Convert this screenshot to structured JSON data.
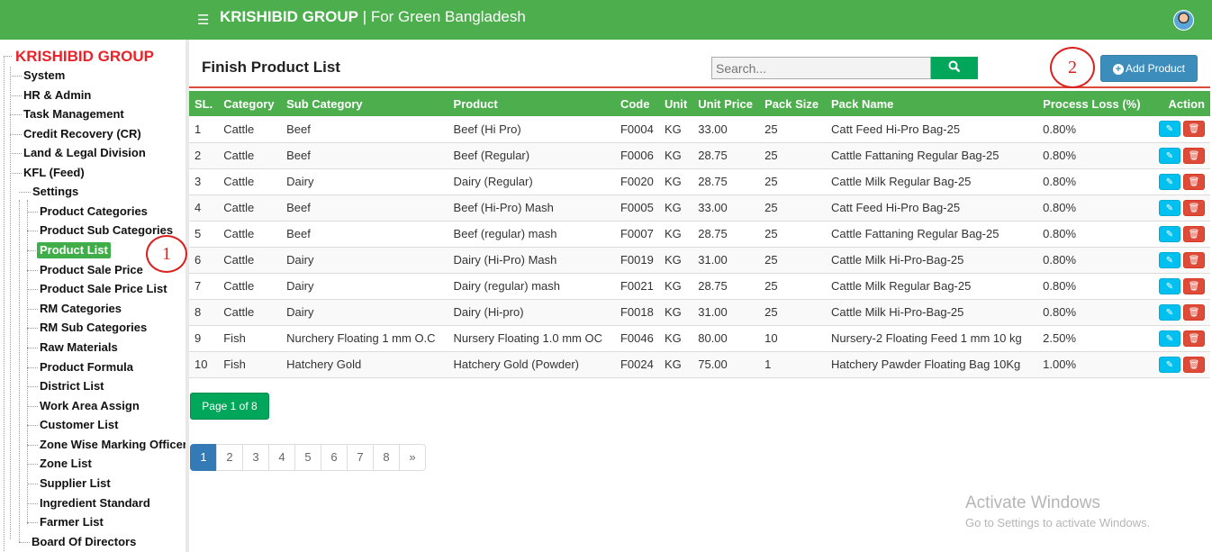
{
  "header": {
    "brand_bold": "KRISHIBID GROUP",
    "brand_rest": " | For Green Bangladesh"
  },
  "sidebar": {
    "title": "KRISHIBID GROUP",
    "items": [
      {
        "label": "System"
      },
      {
        "label": "HR & Admin"
      },
      {
        "label": "Task Management"
      },
      {
        "label": "Credit Recovery (CR)"
      },
      {
        "label": "Land & Legal Division"
      },
      {
        "label": "KFL (Feed)"
      },
      {
        "label": "Settings"
      },
      {
        "label": "Product Categories"
      },
      {
        "label": "Product Sub Categories"
      },
      {
        "label": "Product List"
      },
      {
        "label": "Product Sale Price"
      },
      {
        "label": "Product Sale Price List"
      },
      {
        "label": "RM Categories"
      },
      {
        "label": "RM Sub Categories"
      },
      {
        "label": "Raw Materials"
      },
      {
        "label": "Product Formula"
      },
      {
        "label": "District List"
      },
      {
        "label": "Work Area Assign"
      },
      {
        "label": "Customer List"
      },
      {
        "label": "Zone Wise Marking Officer"
      },
      {
        "label": "Zone List"
      },
      {
        "label": "Supplier List"
      },
      {
        "label": "Ingredient Standard"
      },
      {
        "label": "Farmer List"
      },
      {
        "label": "Board Of Directors"
      }
    ]
  },
  "main": {
    "title": "Finish Product List",
    "search_placeholder": "Search...",
    "add_label": "Add Product",
    "columns": [
      "SL.",
      "Category",
      "Sub Category",
      "Product",
      "Code",
      "Unit",
      "Unit Price",
      "Pack Size",
      "Pack Name",
      "Process Loss (%)",
      "Action"
    ],
    "rows": [
      [
        "1",
        "Cattle",
        "Beef",
        "Beef (Hi Pro)",
        "F0004",
        "KG",
        "33.00",
        "25",
        "Catt Feed Hi-Pro Bag-25",
        "0.80%"
      ],
      [
        "2",
        "Cattle",
        "Beef",
        "Beef (Regular)",
        "F0006",
        "KG",
        "28.75",
        "25",
        "Cattle Fattaning Regular Bag-25",
        "0.80%"
      ],
      [
        "3",
        "Cattle",
        "Dairy",
        "Dairy (Regular)",
        "F0020",
        "KG",
        "28.75",
        "25",
        "Cattle Milk Regular Bag-25",
        "0.80%"
      ],
      [
        "4",
        "Cattle",
        "Beef",
        "Beef (Hi-Pro) Mash",
        "F0005",
        "KG",
        "33.00",
        "25",
        "Catt Feed Hi-Pro Bag-25",
        "0.80%"
      ],
      [
        "5",
        "Cattle",
        "Beef",
        "Beef (regular) mash",
        "F0007",
        "KG",
        "28.75",
        "25",
        "Cattle Fattaning Regular Bag-25",
        "0.80%"
      ],
      [
        "6",
        "Cattle",
        "Dairy",
        "Dairy (Hi-Pro) Mash",
        "F0019",
        "KG",
        "31.00",
        "25",
        "Cattle Milk Hi-Pro-Bag-25",
        "0.80%"
      ],
      [
        "7",
        "Cattle",
        "Dairy",
        "Dairy (regular) mash",
        "F0021",
        "KG",
        "28.75",
        "25",
        "Cattle Milk Regular Bag-25",
        "0.80%"
      ],
      [
        "8",
        "Cattle",
        "Dairy",
        "Dairy (Hi-pro)",
        "F0018",
        "KG",
        "31.00",
        "25",
        "Cattle Milk Hi-Pro-Bag-25",
        "0.80%"
      ],
      [
        "9",
        "Fish",
        "Nurchery Floating 1 mm O.C",
        "Nursery Floating 1.0 mm OC",
        "F0046",
        "KG",
        "80.00",
        "10",
        "Nursery-2 Floating Feed 1 mm 10 kg",
        "2.50%"
      ],
      [
        "10",
        "Fish",
        "Hatchery Gold",
        "Hatchery Gold (Powder)",
        "F0024",
        "KG",
        "75.00",
        "1",
        "Hatchery Pawder Floating Bag 10Kg",
        "1.00%"
      ]
    ],
    "page_badge": "Page 1 of 8",
    "pages": [
      "1",
      "2",
      "3",
      "4",
      "5",
      "6",
      "7",
      "8",
      "»"
    ]
  },
  "annotations": [
    "1",
    "2"
  ],
  "watermark": {
    "line1": "Activate Windows",
    "line2": "Go to Settings to activate Windows."
  }
}
